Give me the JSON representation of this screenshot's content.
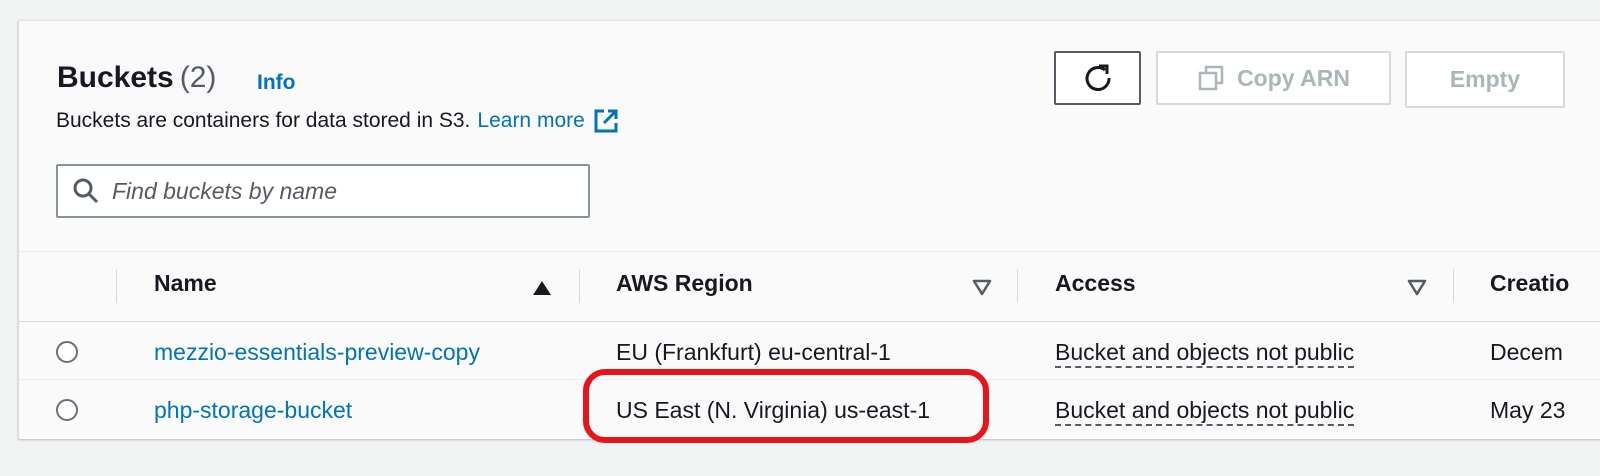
{
  "header": {
    "title": "Buckets",
    "count": "(2)",
    "info_link": "Info",
    "description": "Buckets are containers for data stored in S3.",
    "learn_more": "Learn more"
  },
  "toolbar": {
    "refresh_icon": "refresh-icon",
    "copy_arn_label": "Copy ARN",
    "empty_label": "Empty"
  },
  "search": {
    "placeholder": "Find buckets by name",
    "value": ""
  },
  "table": {
    "columns": [
      "Name",
      "AWS Region",
      "Access",
      "Creatio"
    ],
    "rows": [
      {
        "name": "mezzio-essentials-preview-copy",
        "region": "EU (Frankfurt) eu-central-1",
        "access": "Bucket and objects not public",
        "creation": "Decem"
      },
      {
        "name": "php-storage-bucket",
        "region": "US East (N. Virginia) us-east-1",
        "access": "Bucket and objects not public",
        "creation": "May 23"
      }
    ]
  },
  "colors": {
    "link": "#0073bb",
    "highlight": "#e8141b",
    "disabled_text": "#aab7b8"
  }
}
